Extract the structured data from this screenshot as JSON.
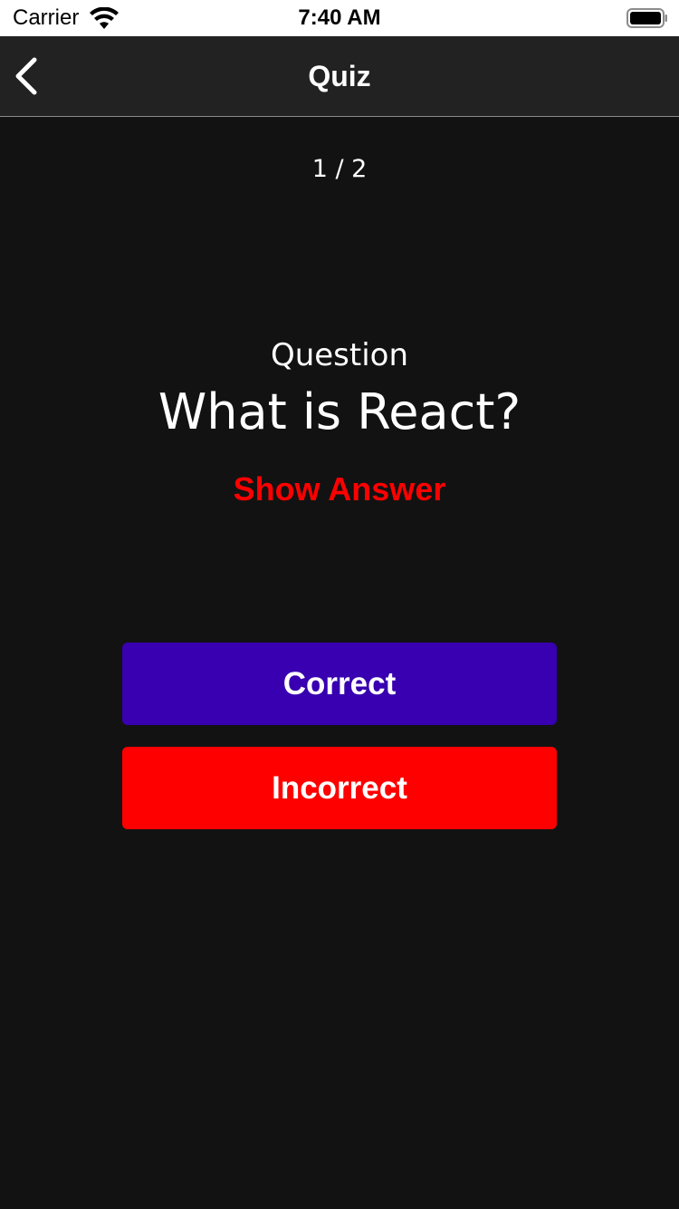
{
  "status_bar": {
    "carrier": "Carrier",
    "time": "7:40 AM",
    "wifi_icon": "wifi-icon",
    "battery_icon": "battery-icon"
  },
  "nav": {
    "title": "Quiz",
    "back_icon": "chevron-left-icon"
  },
  "quiz": {
    "counter": "1 / 2",
    "question_label": "Question",
    "question_text": "What is React?",
    "show_answer_label": "Show Answer",
    "correct_label": "Correct",
    "incorrect_label": "Incorrect"
  },
  "colors": {
    "background": "#121212",
    "nav_background": "#222222",
    "accent_red": "#ff0000",
    "correct_button": "#3800b0",
    "incorrect_button": "#ff0000"
  }
}
